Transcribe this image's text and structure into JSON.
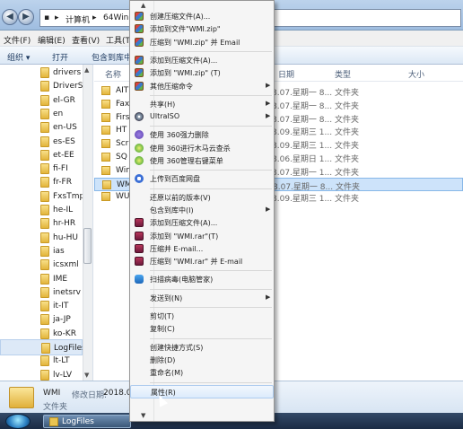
{
  "address": {
    "crumbs": [
      "▸",
      "计算机",
      "▸",
      "64Win7"
    ]
  },
  "menubar": [
    "文件(F)",
    "编辑(E)",
    "查看(V)",
    "工具(T)"
  ],
  "toolbar": {
    "organize": "组织 ▾",
    "open": "打开",
    "include": "包含到库中"
  },
  "nav": {
    "items": [
      "drivers",
      "DriverSto",
      "el-GR",
      "en",
      "en-US",
      "es-ES",
      "et-EE",
      "fi-FI",
      "fr-FR",
      "FxsTmp",
      "he-IL",
      "hr-HR",
      "hu-HU",
      "ias",
      "icsxml",
      "IME",
      "inetsrv",
      "it-IT",
      "ja-JP",
      "ko-KR",
      "LogFiles",
      "lt-LT",
      "lv-LV"
    ],
    "selected": "LogFiles"
  },
  "filelist": {
    "columns": {
      "name": "名称",
      "date": "日期",
      "type": "类型",
      "size": "大小"
    },
    "rows": [
      {
        "name": "AIT",
        "date": "8.07.星期一 8...",
        "type": "文件夹"
      },
      {
        "name": "Fax",
        "date": "8.07.星期一 8...",
        "type": "文件夹"
      },
      {
        "name": "Firs",
        "date": "8.07.星期一 8...",
        "type": "文件夹"
      },
      {
        "name": "HT",
        "date": "8.09.星期三 1...",
        "type": "文件夹"
      },
      {
        "name": "Scr",
        "date": "8.09.星期三 1...",
        "type": "文件夹"
      },
      {
        "name": "SQ",
        "date": "8.06.星期日 1...",
        "type": "文件夹"
      },
      {
        "name": "Win",
        "date": "8.07.星期一 1...",
        "type": "文件夹"
      },
      {
        "name": "WM",
        "date": "8.07.星期一 8...",
        "type": "文件夹"
      },
      {
        "name": "WU",
        "date": "8.09.星期三 1...",
        "type": "文件夹"
      }
    ],
    "selected": "WM"
  },
  "details": {
    "name": "WMI",
    "date_label": "修改日期:",
    "date": "2018.07",
    "type": "文件夹"
  },
  "taskbar": {
    "window_label": "LogFiles"
  },
  "context_menu": {
    "items": [
      {
        "label": "创建压缩文件(A)...",
        "icon": "zip-icon"
      },
      {
        "label": "添加到文件\"WMI.zip\"",
        "icon": "zip-icon"
      },
      {
        "label": "压缩到 \"WMI.zip\" 并 Email",
        "icon": "zip-icon"
      },
      {
        "sep": true
      },
      {
        "label": "添加到压缩文件(A)...",
        "icon": "zip-icon"
      },
      {
        "label": "添加到 \"WMI.zip\" (T)",
        "icon": "zip-icon"
      },
      {
        "label": "其他压缩命令",
        "icon": "zip-icon",
        "submenu": true
      },
      {
        "sep": true
      },
      {
        "label": "共享(H)",
        "submenu": true
      },
      {
        "label": "UltraISO",
        "icon": "iso-icon",
        "submenu": true
      },
      {
        "sep": true
      },
      {
        "label": "使用 360强力删除",
        "icon": "360-icon"
      },
      {
        "label": "使用 360进行木马云查杀",
        "icon": "360g-icon"
      },
      {
        "label": "使用 360管理右键菜单",
        "icon": "360g-icon"
      },
      {
        "sep": true
      },
      {
        "label": "上传到百度网盘",
        "icon": "baidu-icon"
      },
      {
        "sep": true
      },
      {
        "label": "还原以前的版本(V)"
      },
      {
        "label": "包含到库中(I)",
        "submenu": true
      },
      {
        "label": "添加到压缩文件(A)...",
        "icon": "rar-icon"
      },
      {
        "label": "添加到 \"WMI.rar\"(T)",
        "icon": "rar-icon"
      },
      {
        "label": "压缩并 E-mail...",
        "icon": "rar-icon"
      },
      {
        "label": "压缩到 \"WMI.rar\" 并 E-mail",
        "icon": "rar-icon"
      },
      {
        "sep": true
      },
      {
        "label": "扫描病毒(电脑管家)",
        "icon": "shield-icon"
      },
      {
        "sep": true
      },
      {
        "label": "发送到(N)",
        "submenu": true
      },
      {
        "sep": true
      },
      {
        "label": "剪切(T)"
      },
      {
        "label": "复制(C)"
      },
      {
        "sep": true
      },
      {
        "label": "创建快捷方式(S)"
      },
      {
        "label": "删除(D)"
      },
      {
        "label": "重命名(M)"
      },
      {
        "sep": true
      },
      {
        "label": "属性(R)",
        "highlighted": true
      }
    ]
  }
}
